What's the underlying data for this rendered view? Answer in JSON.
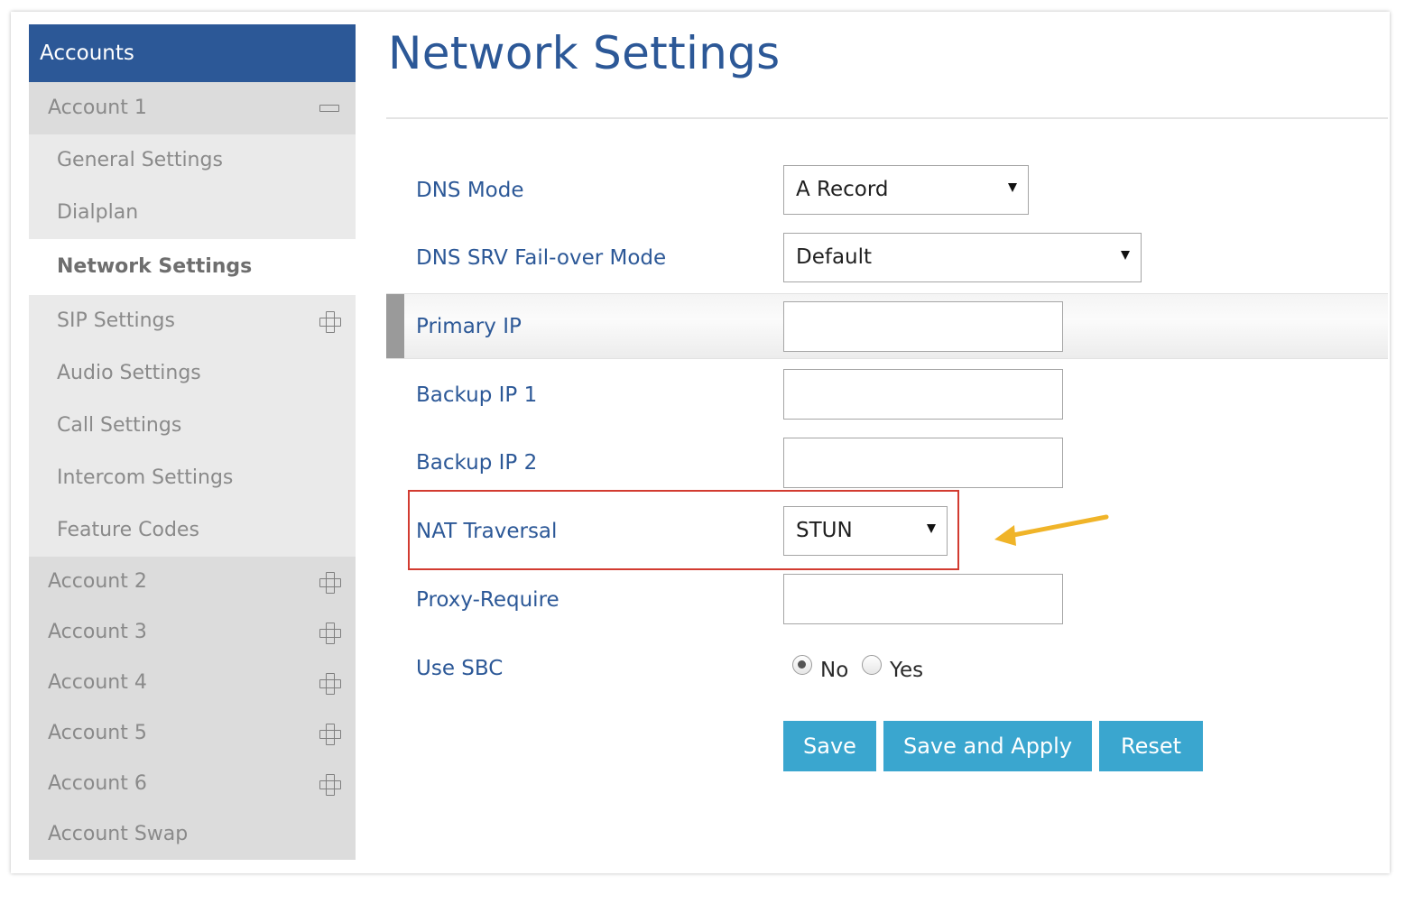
{
  "sidebar": {
    "header": "Accounts",
    "account1": {
      "label": "Account 1",
      "items": [
        "General Settings",
        "Dialplan",
        "Network Settings",
        "SIP Settings",
        "Audio Settings",
        "Call Settings",
        "Intercom Settings",
        "Feature Codes"
      ],
      "active_item": "Network Settings"
    },
    "accounts": [
      "Account 2",
      "Account 3",
      "Account 4",
      "Account 5",
      "Account 6"
    ],
    "swap": "Account Swap"
  },
  "main": {
    "title": "Network Settings",
    "dns_mode": {
      "label": "DNS Mode",
      "value": "A Record"
    },
    "dns_srv_failover": {
      "label": "DNS SRV Fail-over Mode",
      "value": "Default"
    },
    "primary_ip": {
      "label": "Primary IP",
      "value": ""
    },
    "backup_ip1": {
      "label": "Backup IP 1",
      "value": ""
    },
    "backup_ip2": {
      "label": "Backup IP 2",
      "value": ""
    },
    "nat_traversal": {
      "label": "NAT Traversal",
      "value": "STUN"
    },
    "proxy_require": {
      "label": "Proxy-Require",
      "value": ""
    },
    "use_sbc": {
      "label": "Use SBC",
      "options": [
        "No",
        "Yes"
      ],
      "selected": "No"
    },
    "buttons": {
      "save": "Save",
      "save_apply": "Save and Apply",
      "reset": "Reset"
    }
  },
  "colors": {
    "brand": "#2c5897",
    "button": "#3aa6cf",
    "highlight_box": "#d23b30",
    "arrow": "#f0b429"
  }
}
